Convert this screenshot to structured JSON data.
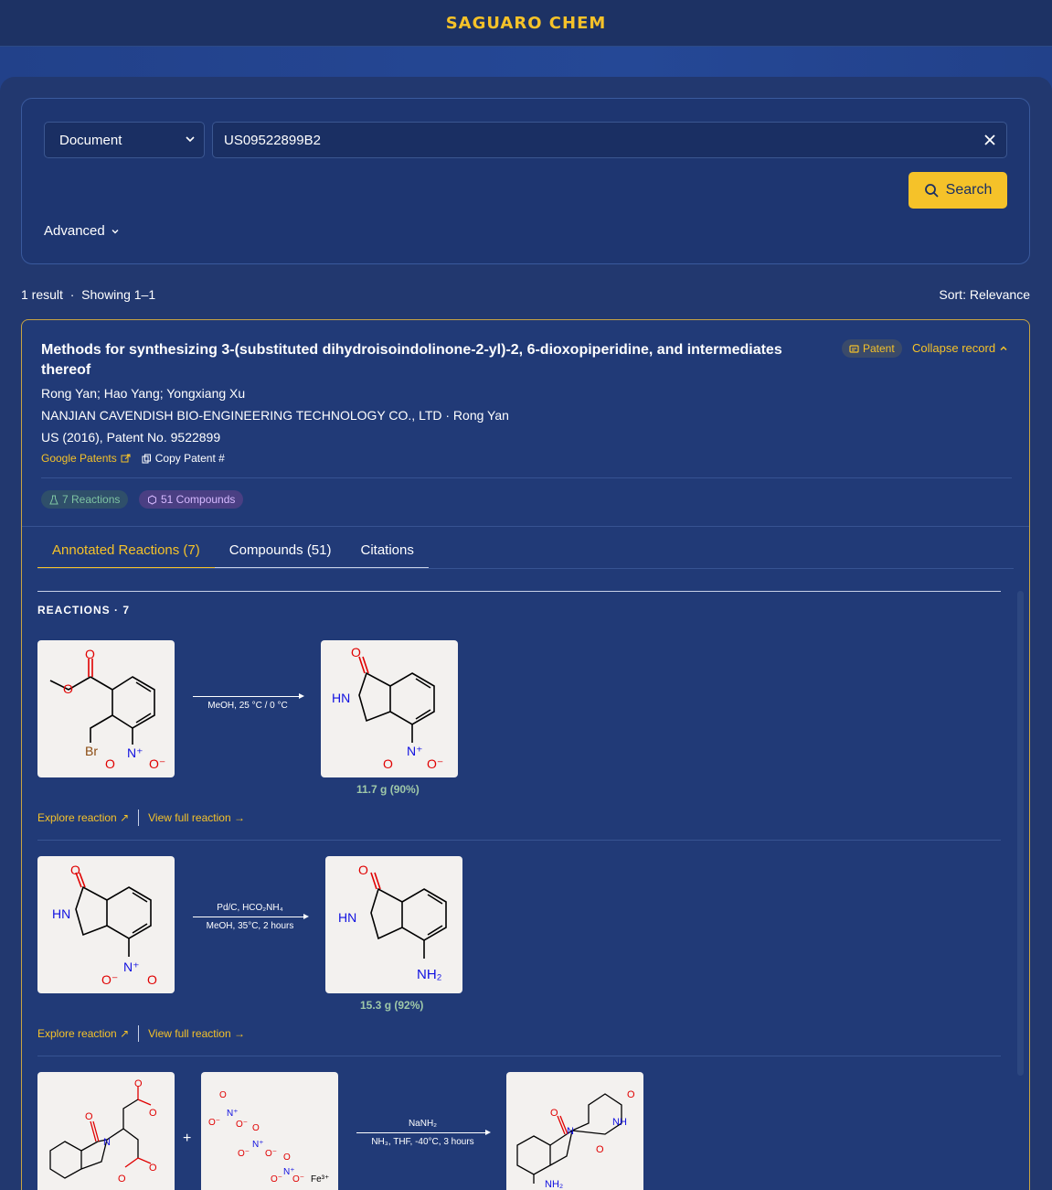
{
  "brand": "SAGUARO CHEM",
  "search": {
    "type_value": "Document",
    "query_value": "US09522899B2",
    "search_label": "Search",
    "advanced_label": "Advanced"
  },
  "results": {
    "count_label": "1 result",
    "showing_label": "Showing 1–1",
    "sort_label": "Sort: Relevance"
  },
  "record": {
    "title": "Methods for synthesizing 3-(substituted dihydroisoindolinone-2-yl)-2, 6-dioxopiperidine, and intermediates thereof",
    "authors": "Rong Yan; Hao Yang; Yongxiang Xu",
    "assignee": "NANJIAN CAVENDISH BIO-ENGINEERING TECHNOLOGY CO., LTD · Rong Yan",
    "patent_info": "US (2016), Patent No. 9522899",
    "badge": "Patent",
    "collapse_label": "Collapse record",
    "google_patents_label": "Google Patents",
    "copy_label": "Copy Patent #",
    "reactions_pill": "7 Reactions",
    "compounds_pill": "51 Compounds"
  },
  "tabs": [
    {
      "label": "Annotated Reactions (7)"
    },
    {
      "label": "Compounds (51)"
    },
    {
      "label": "Citations"
    }
  ],
  "reactions_header": "REACTIONS · 7",
  "reactions": [
    {
      "conditions_top": "",
      "conditions_bottom": "MeOH, 25 °C / 0 °C",
      "yield": "11.7 g (90%)",
      "explore_label": "Explore reaction",
      "view_label": "View full reaction"
    },
    {
      "conditions_top": "Pd/C, HCO₂NH₄",
      "conditions_bottom": "MeOH, 35°C, 2 hours",
      "yield": "15.3 g (92%)",
      "explore_label": "Explore reaction",
      "view_label": "View full reaction"
    },
    {
      "conditions_top": "NaNH₂",
      "conditions_bottom": "NH₃, THF, -40°C, 3 hours"
    }
  ],
  "atoms": {
    "O": "O",
    "O_minus": "O⁻",
    "N_plus": "N⁺",
    "Br": "Br",
    "HN": "HN",
    "NH": "NH",
    "NH2": "NH₂",
    "Fe": "Fe³⁺",
    "plus": "+"
  },
  "colors": {
    "accent": "#f5c229",
    "background": "#22386f",
    "oxygen": "#e00000",
    "nitrogen": "#1010e0"
  }
}
